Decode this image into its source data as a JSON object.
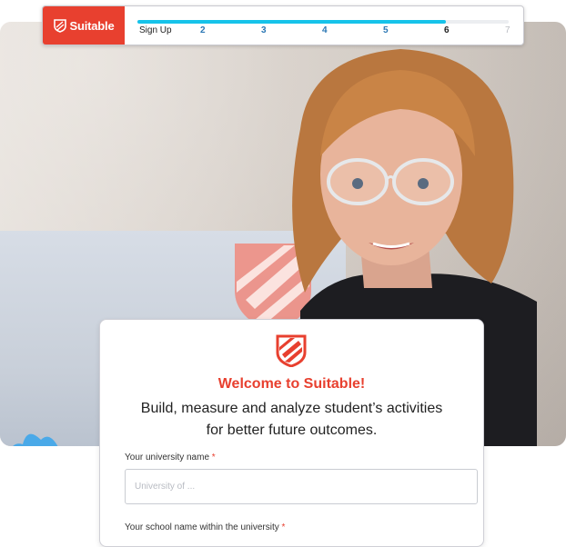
{
  "brand": {
    "name": "Suitable",
    "color": "#e8402f"
  },
  "progress": {
    "fraction": 0.83,
    "accent": "#16c3ea",
    "steps": [
      {
        "label": "Sign Up",
        "state": "done"
      },
      {
        "label": "2",
        "state": "done"
      },
      {
        "label": "3",
        "state": "done"
      },
      {
        "label": "4",
        "state": "done"
      },
      {
        "label": "5",
        "state": "done"
      },
      {
        "label": "6",
        "state": "current"
      },
      {
        "label": "7",
        "state": "future"
      }
    ]
  },
  "card": {
    "welcome": "Welcome to Suitable!",
    "tagline": "Build, measure and analyze student’s activities for better future outcomes.",
    "fields": [
      {
        "label": "Your university name",
        "required_mark": "*",
        "placeholder": "University of ..."
      },
      {
        "label": "Your school name within the university",
        "required_mark": "*"
      }
    ]
  }
}
